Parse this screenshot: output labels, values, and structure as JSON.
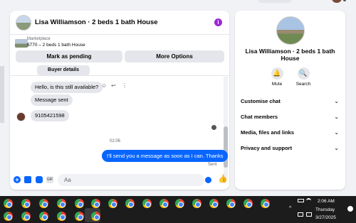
{
  "chat": {
    "title": "Lisa Williamson · 2 beds 1 bath House",
    "info_icon": "i",
    "marketplace": {
      "label": "Marketplace",
      "listing": "$770 – 2 beds 1 bath House",
      "pending_button": "Mark as pending",
      "more_button": "More Options"
    },
    "buyer_details": "Buyer details",
    "messages": {
      "m1": "Hello, is this still available?",
      "m2": "Message sent",
      "m3": "9105421598",
      "timestamp": "02:06",
      "outgoing": "I'll send you a message as soon as I can. Thanks",
      "status": "Sent"
    },
    "composer": {
      "placeholder": "Aa",
      "gif": "GIF",
      "plus": "+",
      "like": "👍"
    }
  },
  "details": {
    "title": "Lisa Williamson · 2 beds 1 bath House",
    "actions": {
      "mute": "Mute",
      "search": "Search"
    },
    "sections": {
      "s1": "Customise chat",
      "s2": "Chat members",
      "s3": "Media, files and links",
      "s4": "Privacy and support"
    }
  },
  "taskbar": {
    "time": "2:06 AM",
    "day": "Thursday",
    "date": "3/27/2025"
  },
  "icons": {
    "react": "☺",
    "reply": "↩",
    "more": "⋮",
    "chevron": "⌄",
    "mute": "🔔",
    "search": "🔍",
    "up": "^"
  },
  "colors": {
    "brand_blue": "#0866ff",
    "info_purple": "#9b27d8",
    "bubble_gray": "#e4e6eb",
    "taskbar": "#1c1c1c"
  }
}
